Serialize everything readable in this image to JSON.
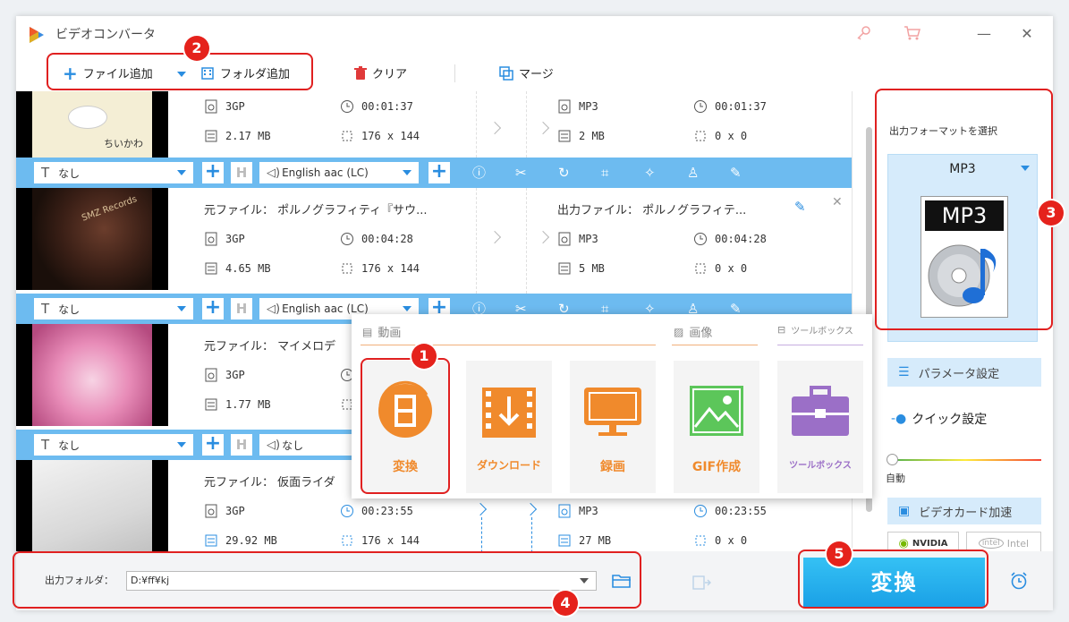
{
  "window": {
    "title": "ビデオコンバータ"
  },
  "toolbar": {
    "add_file": "ファイル追加",
    "add_folder": "フォルダ追加",
    "clear": "クリア",
    "merge": "マージ"
  },
  "files": [
    {
      "src_name": "",
      "src_format": "3GP",
      "src_duration": "00:01:37",
      "src_size": "2.17 MB",
      "src_res": "176 x 144",
      "out_name": "",
      "out_format": "MP3",
      "out_duration": "00:01:37",
      "out_size": "2 MB",
      "out_res": "0 x 0",
      "subtitle": "なし",
      "audio": "English aac (LC)",
      "thumb_text": "ちいかわ"
    },
    {
      "src_name": "元ファイル： ポルノグラフィティ『サウ...",
      "src_format": "3GP",
      "src_duration": "00:04:28",
      "src_size": "4.65 MB",
      "src_res": "176 x 144",
      "out_name": "出力ファイル： ポルノグラフィテ...",
      "out_format": "MP3",
      "out_duration": "00:04:28",
      "out_size": "5 MB",
      "out_res": "0 x 0",
      "subtitle": "なし",
      "audio": "English aac (LC)",
      "thumb_text": "SMZ Records"
    },
    {
      "src_name": "元ファイル： マイメロデ",
      "src_format": "3GP",
      "src_duration": "",
      "src_size": "1.77 MB",
      "src_res": "",
      "subtitle": "なし",
      "audio": "なし"
    },
    {
      "src_name": "元ファイル： 仮面ライダ",
      "src_format": "3GP",
      "src_duration": "00:23:55",
      "src_size": "29.92 MB",
      "src_res": "176 x 144",
      "out_format": "MP3",
      "out_duration": "00:23:55",
      "out_size": "27 MB",
      "out_res": "0 x 0"
    }
  ],
  "popup": {
    "section_video": "動画",
    "section_image": "画像",
    "section_toolbox": "ツールボックス",
    "tiles": [
      {
        "label": "変換",
        "color": "#f08a2c"
      },
      {
        "label": "ダウンロード",
        "color": "#f08a2c"
      },
      {
        "label": "録画",
        "color": "#f08a2c"
      },
      {
        "label": "GIF作成",
        "color": "#f08a2c"
      },
      {
        "label": "ツールボックス",
        "color": "#9b6fc7"
      }
    ]
  },
  "right": {
    "select_label": "出力フォーマットを選択",
    "format": "MP3",
    "format_icon_text": "MP3",
    "param": "パラメータ設定",
    "quick": "クイック設定",
    "auto": "自動",
    "gpu": "ビデオカード加速",
    "nvidia": "NVIDIA",
    "intel": "Intel"
  },
  "bottom": {
    "folder_label": "出力フォルダ：",
    "folder_value": "D:¥ff¥kj",
    "convert": "変換"
  },
  "badges": [
    "1",
    "2",
    "3",
    "4",
    "5"
  ],
  "colors": {
    "accent": "#2a8de0",
    "bar": "#6dbbf0",
    "orange": "#f08a2c",
    "annotation": "#e02020"
  }
}
